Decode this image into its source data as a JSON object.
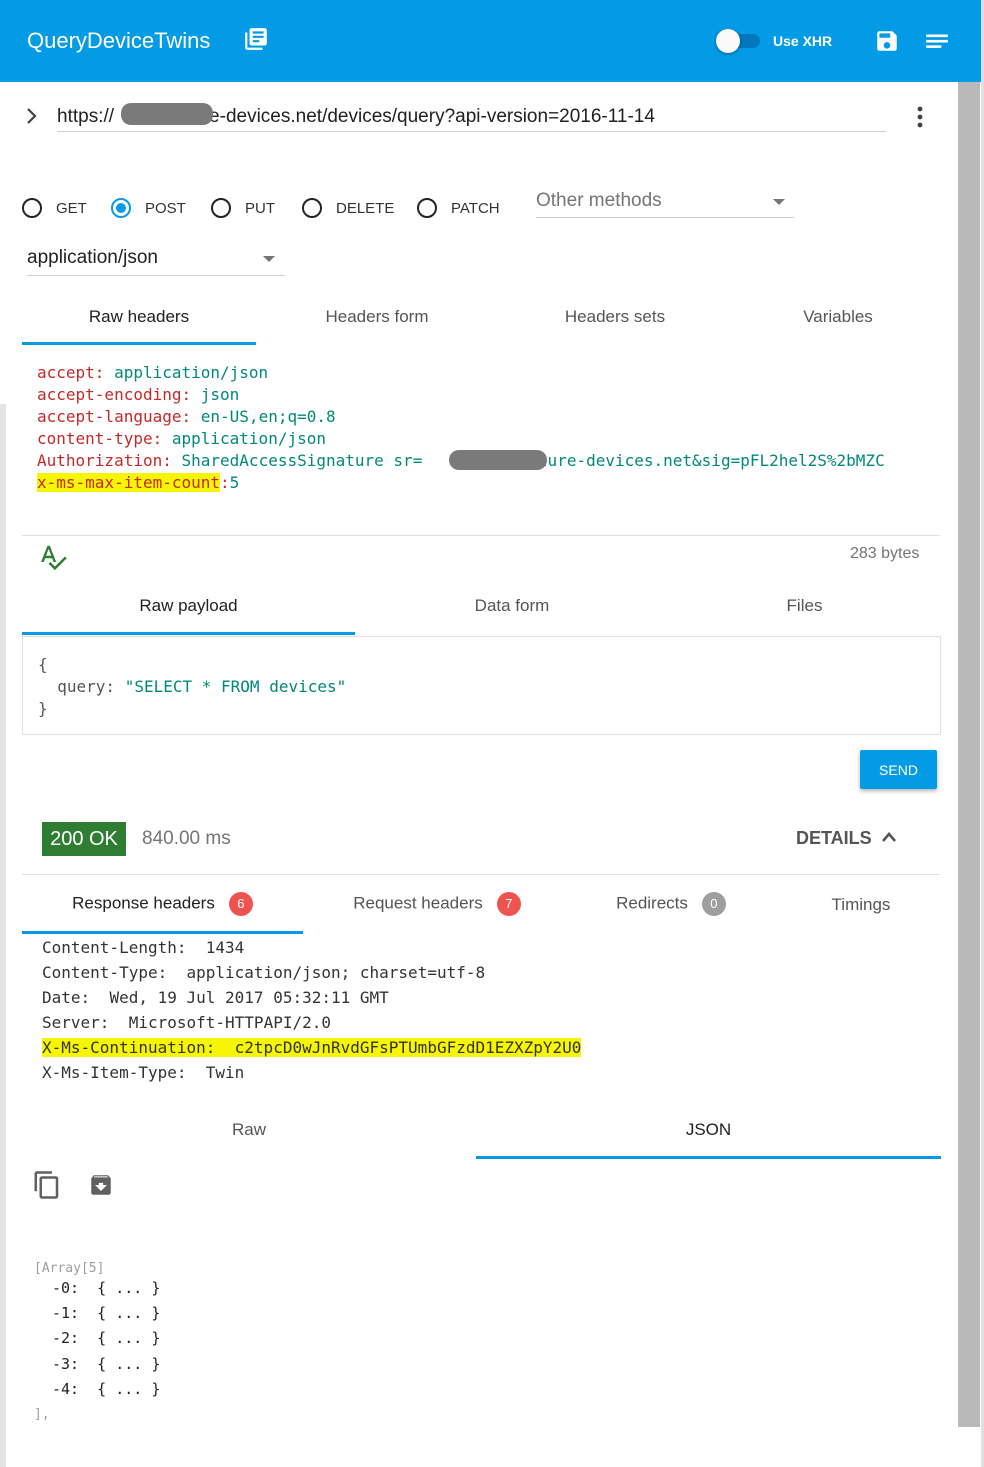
{
  "app": {
    "title": "QueryDeviceTwins",
    "use_xhr_label": "Use XHR",
    "use_xhr_on": false
  },
  "request": {
    "url": "https://          .azure-devices.net/devices/query?api-version=2016-11-14",
    "methods": [
      "GET",
      "POST",
      "PUT",
      "DELETE",
      "PATCH"
    ],
    "selected_method": "POST",
    "other_methods_label": "Other methods",
    "content_type": "application/json"
  },
  "header_tabs": [
    "Raw headers",
    "Headers form",
    "Headers sets",
    "Variables"
  ],
  "raw_headers": [
    {
      "key": "accept",
      "value": "application/json"
    },
    {
      "key": "accept-encoding",
      "value": "json"
    },
    {
      "key": "accept-language",
      "value": "en-US,en;q=0.8"
    },
    {
      "key": "content-type",
      "value": "application/json"
    },
    {
      "key": "Authorization",
      "value": "SharedAccessSignature sr=          .azure-devices.net&sig=pFL2hel2S%2bMZC"
    },
    {
      "key": "x-ms-max-item-count",
      "value": "5"
    }
  ],
  "payload": {
    "size": "283 bytes",
    "tabs": [
      "Raw payload",
      "Data form",
      "Files"
    ],
    "lines": [
      "{",
      "  query: ",
      "}"
    ],
    "query_value": "\"SELECT * FROM devices\"",
    "send_label": "SEND"
  },
  "response": {
    "status": "200 OK",
    "time": "840.00 ms",
    "details_label": "DETAILS",
    "tabs": [
      {
        "label": "Response headers",
        "count": "6"
      },
      {
        "label": "Request headers",
        "count": "7"
      },
      {
        "label": "Redirects",
        "count": "0"
      },
      {
        "label": "Timings",
        "count": ""
      }
    ],
    "headers": [
      {
        "key": "Content-Length:",
        "value": "1434"
      },
      {
        "key": "Content-Type:",
        "value": "application/json; charset=utf-8"
      },
      {
        "key": "Date:",
        "value": "Wed, 19 Jul 2017 05:32:11 GMT"
      },
      {
        "key": "Server:",
        "value": "Microsoft-HTTPAPI/2.0"
      },
      {
        "key": "X-Ms-Continuation:",
        "value": "c2tpcD0wJnRvdGFsPTUmbGFzdD1EZXZpY2U0"
      },
      {
        "key": "X-Ms-Item-Type:",
        "value": "Twin"
      }
    ],
    "body_tabs": [
      "Raw",
      "JSON"
    ],
    "json": {
      "array_label": "[Array[5]",
      "items": [
        "-0:",
        "-1:",
        "-2:",
        "-3:",
        "-4:"
      ],
      "collapsed": "{ ... }",
      "end": "],"
    }
  },
  "colors": {
    "appbar": "#039be5",
    "accent": "#039be5",
    "status_ok": "#2e7d32",
    "header_key": "#c62828",
    "header_value": "#00897b",
    "highlight": "#f6f600"
  }
}
